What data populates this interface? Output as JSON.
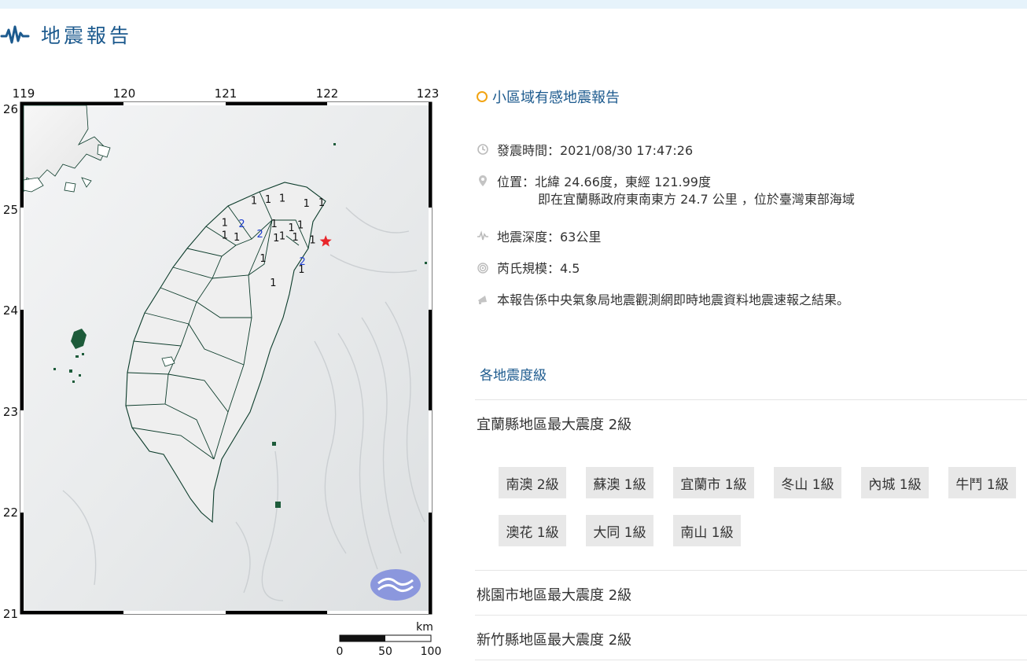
{
  "header": {
    "title": "地震報告"
  },
  "map": {
    "lon_labels": [
      "119",
      "120",
      "121",
      "122",
      "123"
    ],
    "lat_labels": [
      "26",
      "25",
      "24",
      "23",
      "22",
      "21"
    ],
    "scale_unit": "km",
    "scale_labels": [
      "0",
      "50",
      "100"
    ],
    "epicenter_color": "#e8262b",
    "intensity_points": [
      {
        "label": "1",
        "lon": 121.28,
        "lat": 25.03,
        "color": "#111"
      },
      {
        "label": "1",
        "lon": 121.42,
        "lat": 25.04,
        "color": "#111"
      },
      {
        "label": "1",
        "lon": 121.56,
        "lat": 25.05,
        "color": "#111"
      },
      {
        "label": "1",
        "lon": 121.8,
        "lat": 25.0,
        "color": "#111"
      },
      {
        "label": "1",
        "lon": 121.95,
        "lat": 25.01,
        "color": "#111"
      },
      {
        "label": "1",
        "lon": 120.99,
        "lat": 24.81,
        "color": "#111"
      },
      {
        "label": "2",
        "lon": 121.16,
        "lat": 24.8,
        "color": "#1f3fd0"
      },
      {
        "label": "1",
        "lon": 121.48,
        "lat": 24.8,
        "color": "#111"
      },
      {
        "label": "1",
        "lon": 121.65,
        "lat": 24.76,
        "color": "#111"
      },
      {
        "label": "1",
        "lon": 121.74,
        "lat": 24.79,
        "color": "#111"
      },
      {
        "label": "2",
        "lon": 121.34,
        "lat": 24.7,
        "color": "#1f3fd0"
      },
      {
        "label": "1",
        "lon": 120.99,
        "lat": 24.69,
        "color": "#111"
      },
      {
        "label": "1",
        "lon": 121.11,
        "lat": 24.67,
        "color": "#111"
      },
      {
        "label": "1",
        "lon": 121.5,
        "lat": 24.66,
        "color": "#111"
      },
      {
        "label": "1",
        "lon": 121.56,
        "lat": 24.68,
        "color": "#111"
      },
      {
        "label": "1",
        "lon": 121.69,
        "lat": 24.67,
        "color": "#111"
      },
      {
        "label": "1",
        "lon": 121.86,
        "lat": 24.64,
        "color": "#111"
      },
      {
        "label": "1",
        "lon": 121.37,
        "lat": 24.46,
        "color": "#111"
      },
      {
        "label": "2",
        "lon": 121.76,
        "lat": 24.43,
        "color": "#1f3fd0"
      },
      {
        "label": "1",
        "lon": 121.75,
        "lat": 24.35,
        "color": "#111"
      },
      {
        "label": "1",
        "lon": 121.47,
        "lat": 24.22,
        "color": "#111"
      }
    ],
    "epicenter": {
      "lon": 121.99,
      "lat": 24.66
    }
  },
  "report": {
    "type": "小區域有感地震報告",
    "time_label": "發震時間：2021/08/30 17:47:26",
    "location_label": "位置：北緯 24.66度，東經 121.99度",
    "location_detail": "即在宜蘭縣政府東南東方 24.7 公里 ，位於臺灣東部海域",
    "depth_label": "地震深度：63公里",
    "magnitude_label": "芮氏規模：4.5",
    "note": "本報告係中央氣象局地震觀測網即時地震資料地震速報之結果。"
  },
  "intensity": {
    "section_title": "各地震度級",
    "counties": [
      {
        "label": "宜蘭縣地區最大震度 2級"
      },
      {
        "label": "桃園市地區最大震度 2級"
      },
      {
        "label": "新竹縣地區最大震度 2級"
      }
    ],
    "yilan_stations": [
      {
        "label": "南澳 2級"
      },
      {
        "label": "蘇澳 1級"
      },
      {
        "label": "宜蘭市 1級"
      },
      {
        "label": "冬山 1級"
      },
      {
        "label": "內城 1級"
      },
      {
        "label": "牛鬥 1級"
      },
      {
        "label": "澳花 1級"
      },
      {
        "label": "大同 1級"
      },
      {
        "label": "南山 1級"
      }
    ]
  },
  "colors": {
    "accent": "#1c5a8e",
    "ring": "#f2a413",
    "intensity2": "#1f3fd0"
  },
  "icons": [
    "waveform-icon",
    "clock-icon",
    "location-pin-icon",
    "depth-icon",
    "magnitude-icon",
    "megaphone-icon",
    "ring-icon",
    "logo-emblem-icon"
  ]
}
